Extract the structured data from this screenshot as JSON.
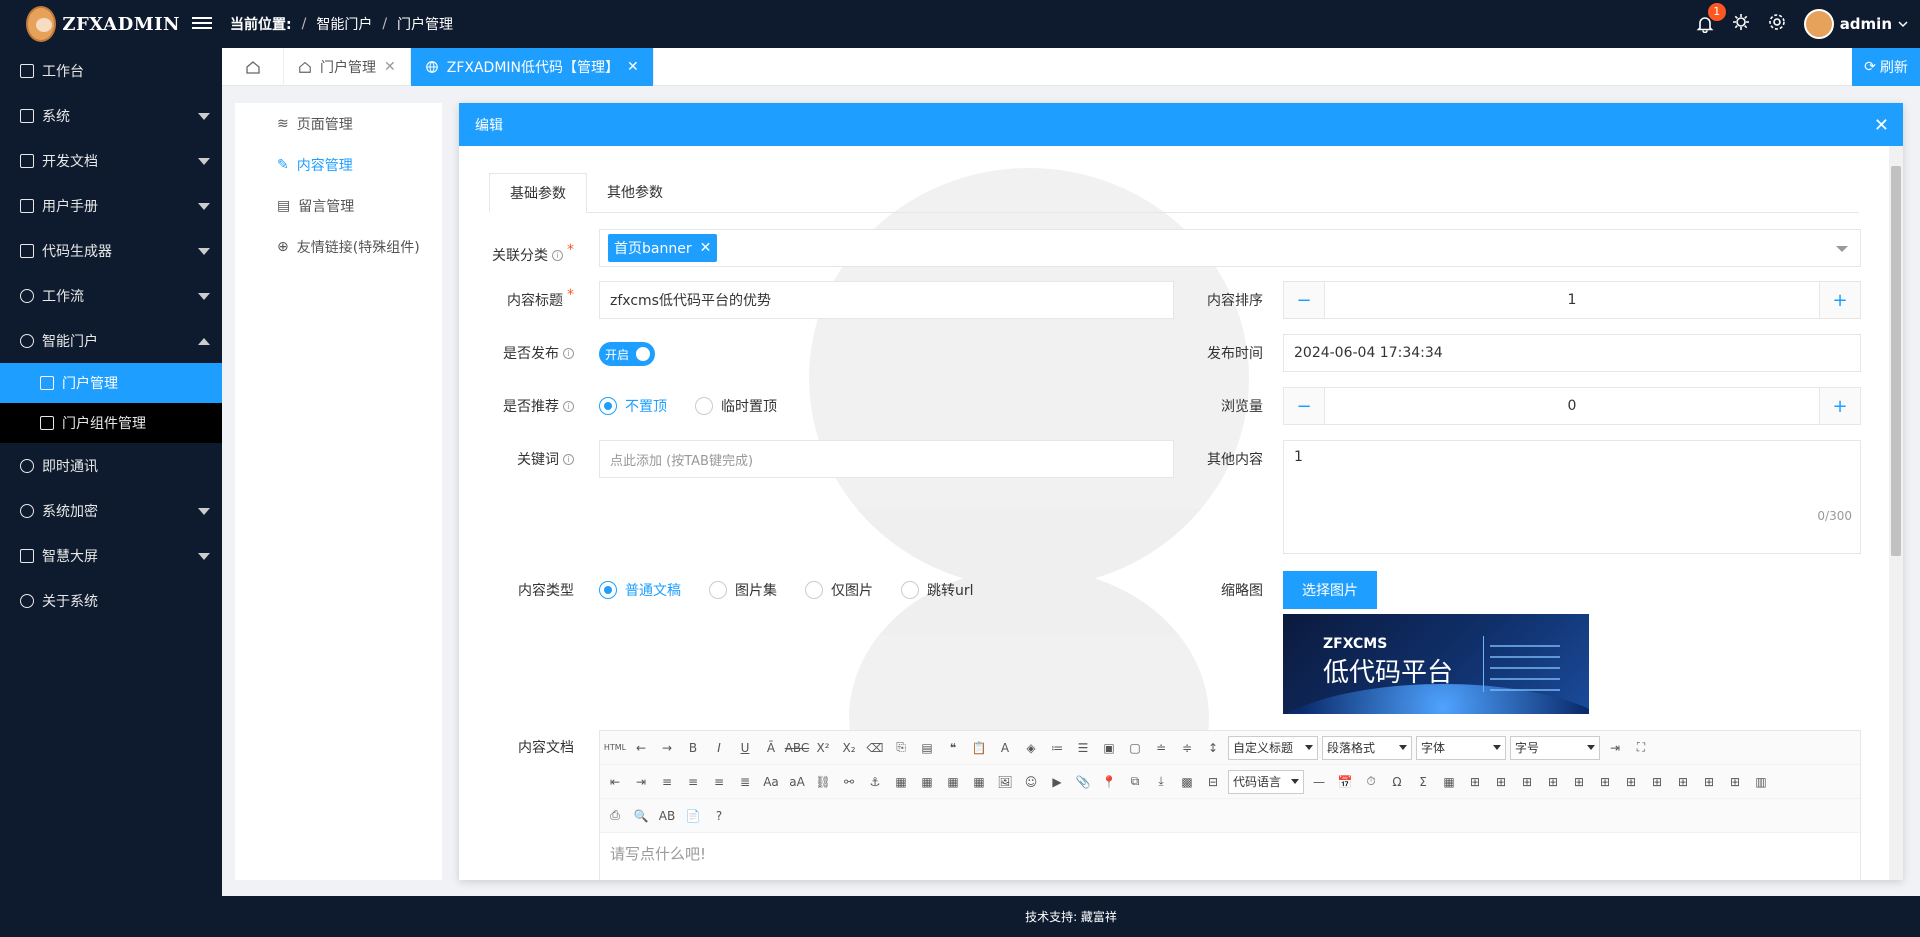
{
  "header": {
    "logo_text": "ZFXADMIN",
    "breadcrumb_label": "当前位置:",
    "breadcrumb": [
      "智能门户",
      "门户管理"
    ],
    "notification_count": "1",
    "username": "admin"
  },
  "sidebar": {
    "items": [
      {
        "label": "工作台",
        "icon": "home-icon"
      },
      {
        "label": "系统",
        "icon": "apps-icon"
      },
      {
        "label": "开发文档",
        "icon": "book-icon"
      },
      {
        "label": "用户手册",
        "icon": "manual-icon"
      },
      {
        "label": "代码生成器",
        "icon": "code-icon"
      },
      {
        "label": "工作流",
        "icon": "flow-icon"
      },
      {
        "label": "智能门户",
        "icon": "globe-icon"
      },
      {
        "label": "即时通讯",
        "icon": "chat-icon"
      },
      {
        "label": "系统加密",
        "icon": "key-icon"
      },
      {
        "label": "智慧大屏",
        "icon": "screen-icon"
      },
      {
        "label": "关于系统",
        "icon": "info-icon"
      }
    ],
    "sub_items": [
      {
        "label": "门户管理",
        "icon": "home-icon"
      },
      {
        "label": "门户组件管理",
        "icon": "component-icon"
      }
    ]
  },
  "tabs": {
    "items": [
      {
        "label": "门户管理"
      },
      {
        "label": "ZFXADMIN低代码【管理】"
      }
    ],
    "refresh_label": "刷新"
  },
  "leftnav": {
    "items": [
      {
        "label": "页面管理",
        "icon": "layers-icon"
      },
      {
        "label": "内容管理",
        "icon": "pencil-icon"
      },
      {
        "label": "留言管理",
        "icon": "clipboard-icon"
      },
      {
        "label": "友情链接(特殊组件)",
        "icon": "globe-icon"
      }
    ]
  },
  "modal": {
    "title": "编辑",
    "tabs": [
      "基础参数",
      "其他参数"
    ],
    "fields": {
      "category_label": "关联分类",
      "category_tag": "首页banner",
      "title_label": "内容标题",
      "title_value": "zfxcms低代码平台的优势",
      "sort_label": "内容排序",
      "sort_value": "1",
      "publish_label": "是否发布",
      "publish_switch": "开启",
      "publish_time_label": "发布时间",
      "publish_time_value": "2024-06-04 17:34:34",
      "recommend_label": "是否推荐",
      "recommend_options": [
        "不置顶",
        "临时置顶"
      ],
      "views_label": "浏览量",
      "views_value": "0",
      "keywords_label": "关键词",
      "keywords_placeholder": "点此添加 (按TAB键完成)",
      "other_label": "其他内容",
      "other_value": "1",
      "other_counter": "0/300",
      "type_label": "内容类型",
      "type_options": [
        "普通文稿",
        "图片集",
        "仅图片",
        "跳转url"
      ],
      "thumb_label": "缩略图",
      "thumb_button": "选择图片",
      "thumb_title": "ZFXCMS",
      "thumb_subtitle": "低代码平台",
      "doc_label": "内容文档"
    },
    "editor": {
      "selects": [
        "自定义标题",
        "段落格式",
        "字体",
        "字号"
      ],
      "code_select": "代码语言",
      "placeholder": "请写点什么吧!"
    }
  },
  "footer": {
    "text": "技术支持: 藏富祥"
  },
  "colors": {
    "primary": "#1e9fff",
    "dark": "#0e1b2e",
    "badge": "#ff5722"
  }
}
